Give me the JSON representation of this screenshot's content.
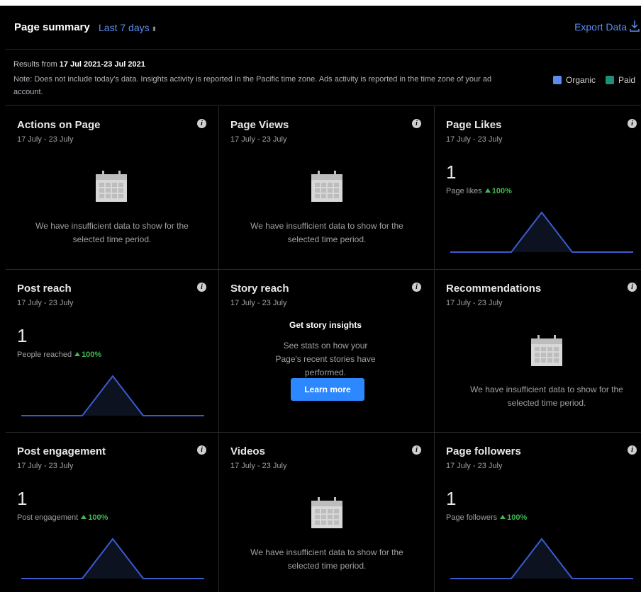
{
  "header": {
    "title": "Page summary",
    "range": "Last 7 days",
    "export_label": "Export Data"
  },
  "info": {
    "results_prefix": "Results from ",
    "results_range": "17 Jul 2021-23 Jul 2021",
    "note": "Note: Does not include today's data. Insights activity is reported in the Pacific time zone. Ads activity is reported in the time zone of your ad account.",
    "legend": [
      {
        "label": "Organic",
        "color": "#5b8def"
      },
      {
        "label": "Paid",
        "color": "#1f8f7a"
      }
    ]
  },
  "insufficient_text": "We have insufficient data to show for the selected time period.",
  "cards": {
    "actions_on_page": {
      "title": "Actions on Page",
      "date": "17 July - 23 July"
    },
    "page_views": {
      "title": "Page Views",
      "date": "17 July - 23 July"
    },
    "page_likes": {
      "title": "Page Likes",
      "date": "17 July - 23 July",
      "value": "1",
      "metric_label": "Page likes",
      "change": "100%"
    },
    "post_reach": {
      "title": "Post reach",
      "date": "17 July - 23 July",
      "value": "1",
      "metric_label": "People reached",
      "change": "100%"
    },
    "story_reach": {
      "title": "Story reach",
      "date": "17 July - 23 July",
      "promo_title": "Get story insights",
      "promo_desc": "See stats on how your Page's recent stories have performed.",
      "button_label": "Learn more"
    },
    "recommendations": {
      "title": "Recommendations",
      "date": "17 July - 23 July"
    },
    "post_engagement": {
      "title": "Post engagement",
      "date": "17 July - 23 July",
      "value": "1",
      "metric_label": "Post engagement",
      "change": "100%"
    },
    "videos": {
      "title": "Videos",
      "date": "17 July - 23 July"
    },
    "page_followers": {
      "title": "Page followers",
      "date": "17 July - 23 July",
      "value": "1",
      "metric_label": "Page followers",
      "change": "100%"
    }
  },
  "colors": {
    "accent": "#5b8def",
    "line": "#3a5bd0",
    "positive": "#3fb950",
    "button": "#2d88ff"
  }
}
